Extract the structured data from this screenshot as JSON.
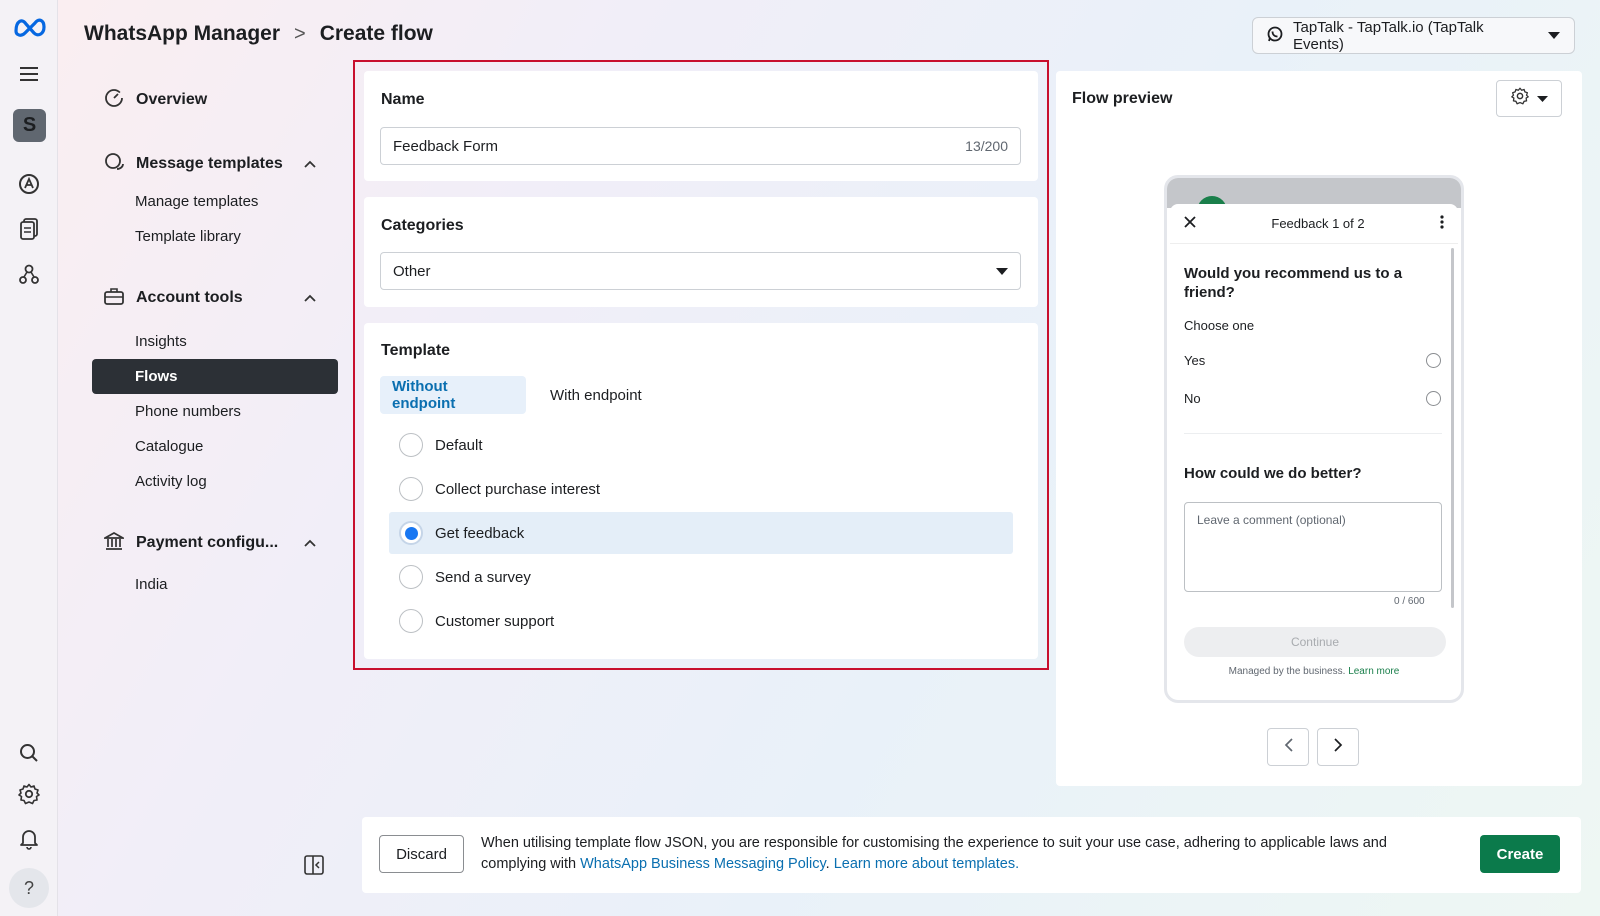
{
  "header": {
    "app_name": "WhatsApp Manager",
    "separator": ">",
    "page": "Create flow",
    "account_label": "TapTalk - TapTalk.io (TapTalk Events)"
  },
  "rail": {
    "avatar_letter": "S",
    "help_label": "?"
  },
  "nav": {
    "overview": "Overview",
    "message_templates": "Message templates",
    "manage_templates": "Manage templates",
    "template_library": "Template library",
    "account_tools": "Account tools",
    "insights": "Insights",
    "flows": "Flows",
    "phone_numbers": "Phone numbers",
    "catalogue": "Catalogue",
    "activity_log": "Activity log",
    "payment_config": "Payment configu...",
    "india": "India"
  },
  "form": {
    "name_label": "Name",
    "name_value": "Feedback Form",
    "name_count": "13/200",
    "categories_label": "Categories",
    "category_value": "Other",
    "template_label": "Template",
    "tab_without": "Without endpoint",
    "tab_with": "With endpoint",
    "options": [
      "Default",
      "Collect purchase interest",
      "Get feedback",
      "Send a survey",
      "Customer support"
    ],
    "selected_option": "Get feedback"
  },
  "preview": {
    "title": "Flow preview",
    "sheet_title": "Feedback 1 of 2",
    "q1": "Would you recommend us to a friend?",
    "choose_one": "Choose one",
    "yes": "Yes",
    "no": "No",
    "q2": "How could we do better?",
    "comment_placeholder": "Leave a comment (optional)",
    "comment_count": "0 / 600",
    "continue": "Continue",
    "managed": "Managed by the business.",
    "learn_more": "Learn more"
  },
  "footer": {
    "discard": "Discard",
    "notice_pre": "When utilising template flow JSON, you are responsible for customising the experience to suit your use case, adhering to applicable laws and complying with ",
    "policy_link": "WhatsApp Business Messaging Policy",
    "notice_mid": ". ",
    "learn_link": "Learn more about templates.",
    "create": "Create"
  },
  "colors": {
    "accent_blue": "#1877f2",
    "create_green": "#0b7a4b",
    "highlight_red": "#c8102e"
  }
}
